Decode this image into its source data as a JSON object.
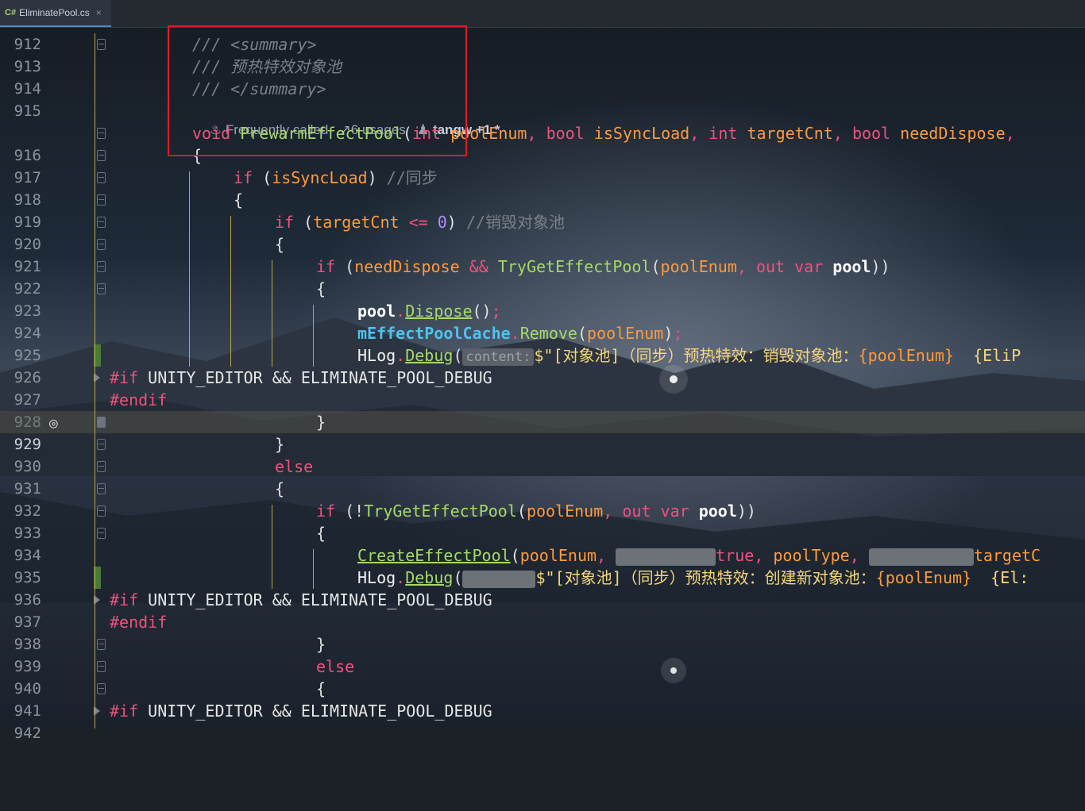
{
  "tab": {
    "lang_badge": "C#",
    "filename": "EliminatePool.cs",
    "close_glyph": "×"
  },
  "partial_line_number": "912",
  "inlay": {
    "frequently": "Frequently called",
    "usages": "6 usages",
    "author": "tangw +1 *"
  },
  "lines": [
    {
      "n": "913"
    },
    {
      "n": "914"
    },
    {
      "n": "915"
    },
    {
      "n": "916"
    },
    {
      "n": "917"
    },
    {
      "n": "918"
    },
    {
      "n": "919"
    },
    {
      "n": "920"
    },
    {
      "n": "921"
    },
    {
      "n": "922"
    },
    {
      "n": "923"
    },
    {
      "n": "924"
    },
    {
      "n": "925"
    },
    {
      "n": "926"
    },
    {
      "n": "927"
    },
    {
      "n": "928"
    },
    {
      "n": "929"
    },
    {
      "n": "930"
    },
    {
      "n": "931"
    },
    {
      "n": "932"
    },
    {
      "n": "933"
    },
    {
      "n": "934"
    },
    {
      "n": "935"
    },
    {
      "n": "936"
    },
    {
      "n": "937"
    },
    {
      "n": "938"
    },
    {
      "n": "939"
    },
    {
      "n": "940"
    },
    {
      "n": "941"
    },
    {
      "n": "942"
    }
  ],
  "code": {
    "doc_prefix": "///",
    "summary_open": "<summary>",
    "summary_text": "预热特效对象池",
    "summary_close": "</summary>",
    "kw_void": "void",
    "method_name": "PrewarmEffectPool",
    "kw_int": "int",
    "kw_bool": "bool",
    "p_poolEnum": "poolEnum",
    "p_isSyncLoad": "isSyncLoad",
    "p_targetCnt": "targetCnt",
    "p_needDispose": "needDispose",
    "kw_if": "if",
    "kw_else": "else",
    "kw_out": "out",
    "kw_var": "var",
    "comment_sync": "//同步",
    "comment_destroy": "//销毁对象池",
    "zero": "0",
    "op_le": "<=",
    "op_and": "&&",
    "tryget": "TryGetEffectPool",
    "pool": "pool",
    "dispose": "Dispose",
    "cache_field": "mEffectPoolCache",
    "remove": "Remove",
    "hlog": "HLog",
    "debug": "Debug",
    "hint_content": "content:",
    "str_destroy": "$\"[对象池]（同步）预热特效：销毁对象池：",
    "str_destroy_tail": "  {EliP",
    "pre_if": "#if",
    "pre_endif": "#endif",
    "pre_cond": "UNITY_EDITOR && ELIMINATE_POOL_DEBUG",
    "create": "CreateEffectPool",
    "kw_true": "true",
    "pool_type": "poolType",
    "target_tail": "targetC",
    "str_create": "$\"[对象池]（同步）预热特效：创建新对象池：",
    "str_create_tail": "  {El:",
    "interp_pool": "{poolEnum}"
  },
  "colors": {
    "keyword": "#f0527d",
    "method": "#a6d96a",
    "parameter": "#ff9a3c",
    "comment": "#7a8088",
    "field": "#4ec3f0",
    "annotation_box": "#e01b24"
  }
}
